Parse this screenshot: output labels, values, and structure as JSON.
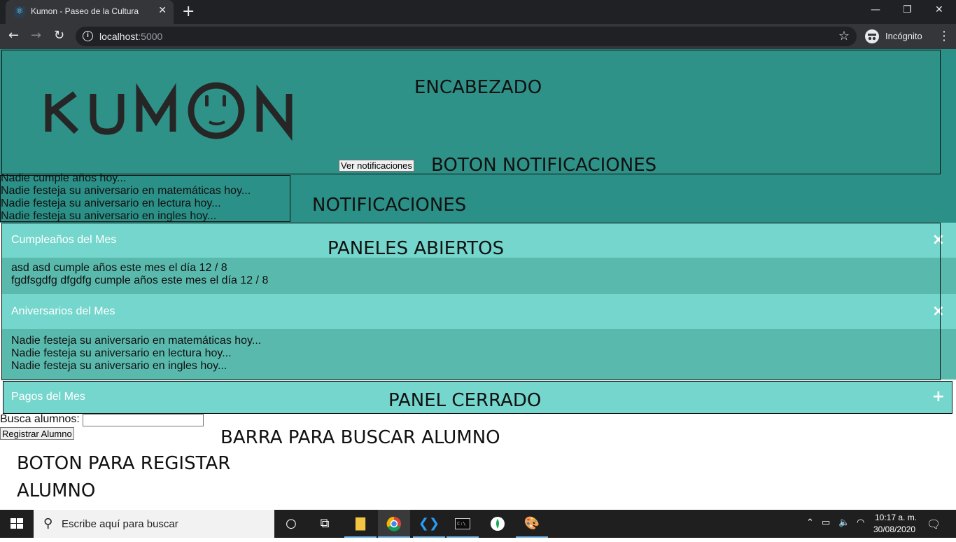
{
  "browser": {
    "tab_title": "Kumon - Paseo de la Cultura",
    "url_host": "localhost",
    "url_port": ":5000",
    "incognito_label": "Incógnito"
  },
  "page": {
    "logo_text": "KUMON",
    "annotations": {
      "header": "ENCABEZADO",
      "notif_button": "BOTON NOTIFICACIONES",
      "notifications": "NOTIFICACIONES",
      "open_panels": "PANELES ABIERTOS",
      "closed_panel": "PANEL CERRADO",
      "search_bar": "BARRA PARA BUSCAR ALUMNO",
      "register_button_1": "BOTON PARA REGISTAR",
      "register_button_2": "ALUMNO"
    },
    "notif_button_label": "Ver notificaciones",
    "notifications": [
      "Nadie cumple años hoy...",
      "Nadie festeja su aniversario en matemáticas hoy...",
      "Nadie festeja su aniversario en lectura hoy...",
      "Nadie festeja su aniversario en ingles hoy..."
    ],
    "panels": [
      {
        "title": "Cumpleaños del Mes",
        "toggle": "×",
        "lines": [
          "asd asd cumple años este mes el día 12 / 8",
          "fgdfsgdfg dfgdfg cumple años este mes el día 12 / 8"
        ]
      },
      {
        "title": "Aniversarios del Mes",
        "toggle": "×",
        "lines": [
          "Nadie festeja su aniversario en matemáticas hoy...",
          "Nadie festeja su aniversario en lectura hoy...",
          "Nadie festeja su aniversario en ingles hoy..."
        ]
      },
      {
        "title": "Pagos del Mes",
        "toggle": "+"
      }
    ],
    "search_label": "Busca alumnos:",
    "search_value": "",
    "register_button_label": "Registrar Alumno"
  },
  "taskbar": {
    "search_placeholder": "Escribe aquí para buscar",
    "time": "10:17 a. m.",
    "date": "30/08/2020"
  }
}
